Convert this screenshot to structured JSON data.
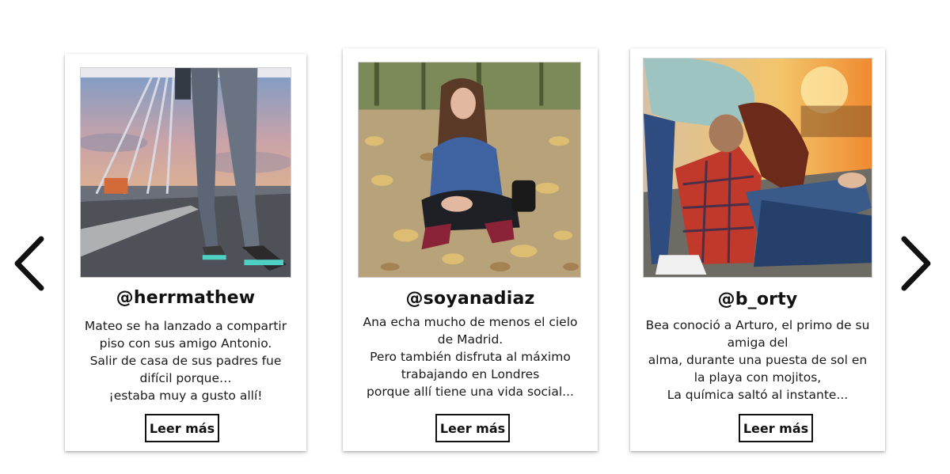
{
  "carousel": {
    "prev_icon": "chevron-left-icon",
    "next_icon": "chevron-right-icon",
    "cards": [
      {
        "username": "@herrmathew",
        "description": [
          "Mateo se ha lanzado a compartir",
          "piso con sus amigo Antonio.",
          "Salir de casa de sus padres fue",
          "difícil porque…",
          "¡estaba muy a gusto allí!"
        ],
        "button_label": "Leer más"
      },
      {
        "username": "@soyanadiaz",
        "description": [
          "Ana echa mucho de menos el cielo",
          "de Madrid.",
          "Pero también disfruta al máximo",
          "trabajando en Londres",
          "porque allí tiene una vida social..."
        ],
        "button_label": "Leer más"
      },
      {
        "username": "@b_orty",
        "description": [
          "Bea conoció a Arturo, el primo de su",
          "amiga del",
          "alma, durante una puesta de sol en",
          "la playa con mojitos,",
          "La química saltó al instante..."
        ],
        "button_label": "Leer más"
      }
    ]
  }
}
